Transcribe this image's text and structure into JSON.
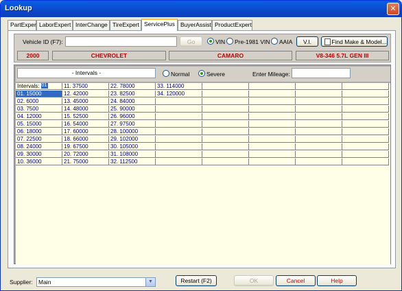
{
  "window": {
    "title": "Lookup",
    "close_glyph": "✕"
  },
  "tabs": [
    "PartExpert",
    "LaborExpert",
    "InterChange",
    "TireExpert",
    "ServicePlus",
    "BuyerAssist",
    "ProductExpert"
  ],
  "active_tab": "ServicePlus",
  "vehicle": {
    "id_label": "Vehicle ID (F7):",
    "id_value": "",
    "go_label": "Go",
    "radio_vin": "VIN",
    "radio_pre1981": "Pre-1981 VIN",
    "radio_aaia": "AAIA",
    "vi_label": "V.I.",
    "find_label": "Find Make & Model...",
    "year": "2000",
    "make": "CHEVROLET",
    "model": "CAMARO",
    "engine": "V8-346  5.7L GEN III"
  },
  "intervals_panel": {
    "intervals_field": "- Intervals -",
    "radio_normal": "Normal",
    "radio_severe": "Severe",
    "mileage_label": "Enter Mileage:",
    "mileage_value": ""
  },
  "table": {
    "header_label": "Intervals:",
    "header_badge": "01",
    "columns": [
      [
        "01. 15000",
        "02. 6000",
        "03. 7500",
        "04. 12000",
        "05. 15000",
        "06. 18000",
        "07. 22500",
        "08. 24000",
        "09. 30000",
        "10. 36000"
      ],
      [
        "11. 37500",
        "12. 42000",
        "13. 45000",
        "14. 48000",
        "15. 52500",
        "16. 54000",
        "17. 60000",
        "18. 66000",
        "19. 67500",
        "20. 72000",
        "21. 75000"
      ],
      [
        "22. 78000",
        "23. 82500",
        "24. 84000",
        "25. 90000",
        "26. 96000",
        "27. 97500",
        "28. 100000",
        "29. 102000",
        "30. 105000",
        "31. 108000",
        "32. 112500"
      ],
      [
        "33. 114000",
        "34. 120000"
      ]
    ]
  },
  "footer": {
    "supplier_label": "Supplier:",
    "supplier_value": "Main",
    "dropdown_glyph": "▼",
    "restart_label": "Restart (F2)",
    "ok_label": "OK",
    "cancel_label": "Cancel",
    "help_label": "Help"
  },
  "colors": {
    "accent_red": "#c00000",
    "selection_blue": "#316ac5",
    "grid_bg": "#fffee6"
  }
}
